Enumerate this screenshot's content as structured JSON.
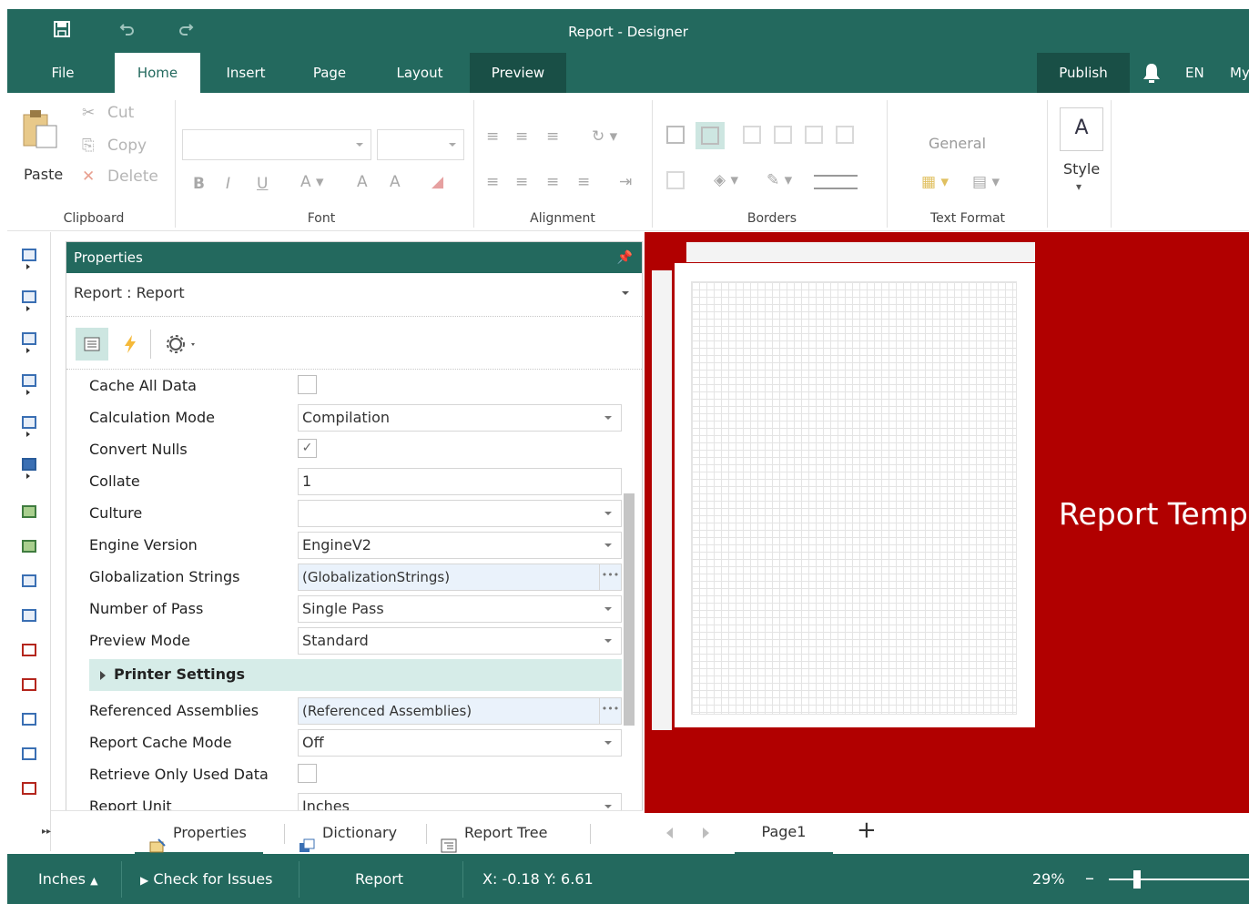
{
  "window": {
    "title": "Report - Designer"
  },
  "colors": {
    "accent": "#23695e",
    "accent_dark": "#194f46",
    "canvas_bg": "#b10000",
    "selection": "#d6ece8"
  },
  "tabs": [
    "File",
    "Home",
    "Insert",
    "Page",
    "Layout",
    "Preview"
  ],
  "active_tab": "Home",
  "right_menu": {
    "publish": "Publish",
    "lang": "EN",
    "user": "My"
  },
  "ribbon": {
    "clipboard": {
      "paste": "Paste",
      "cut": "Cut",
      "copy": "Copy",
      "delete": "Delete",
      "label": "Clipboard"
    },
    "font": {
      "label": "Font",
      "bold": "B",
      "italic": "I",
      "underline": "U"
    },
    "alignment": {
      "label": "Alignment"
    },
    "borders": {
      "label": "Borders"
    },
    "text_format": {
      "label": "Text Format",
      "format": "General"
    },
    "style": {
      "label": "Style"
    }
  },
  "properties": {
    "title": "Properties",
    "object": "Report : Report",
    "rows": [
      {
        "name": "Cache All Data",
        "type": "check",
        "checked": false
      },
      {
        "name": "Calculation Mode",
        "type": "dropdown",
        "value": "Compilation"
      },
      {
        "name": "Convert Nulls",
        "type": "check",
        "checked": true
      },
      {
        "name": "Collate",
        "type": "text",
        "value": "1"
      },
      {
        "name": "Culture",
        "type": "dropdown",
        "value": ""
      },
      {
        "name": "Engine Version",
        "type": "dropdown",
        "value": "EngineV2"
      },
      {
        "name": "Globalization Strings",
        "type": "editor",
        "value": "(GlobalizationStrings)"
      },
      {
        "name": "Number of Pass",
        "type": "dropdown",
        "value": "Single Pass"
      },
      {
        "name": "Preview Mode",
        "type": "dropdown",
        "value": "Standard"
      },
      {
        "name": "Printer Settings",
        "type": "category"
      },
      {
        "name": "Referenced Assemblies",
        "type": "editor",
        "value": "(Referenced Assemblies)"
      },
      {
        "name": "Report Cache Mode",
        "type": "dropdown",
        "value": "Off"
      },
      {
        "name": "Retrieve Only Used Data",
        "type": "check",
        "checked": false
      },
      {
        "name": "Report Unit",
        "type": "dropdown",
        "value": "Inches"
      }
    ]
  },
  "panel_tabs": [
    "Properties",
    "Dictionary",
    "Report Tree"
  ],
  "canvas": {
    "template_title": "Report Templ",
    "page_tab": "Page1"
  },
  "status": {
    "units": "Inches",
    "check": "Check for Issues",
    "object": "Report",
    "coords": "X: -0.18 Y: 6.61",
    "zoom": "29%",
    "zoom_level": 0.2
  }
}
